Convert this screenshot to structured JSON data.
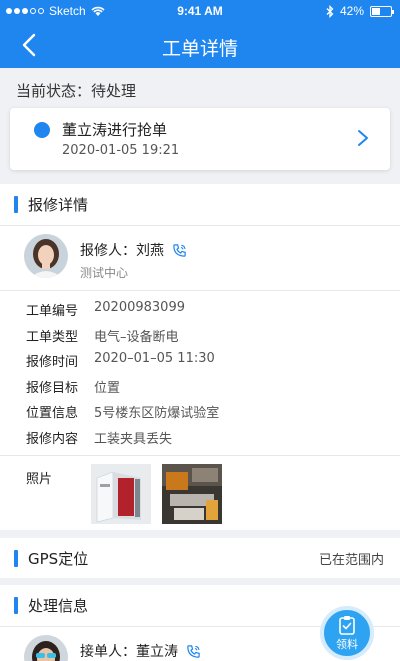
{
  "status_bar": {
    "carrier": "Sketch",
    "time": "9:41 AM",
    "battery": "42%",
    "battery_level": 0.42
  },
  "header": {
    "title": "工单详情"
  },
  "status_line": "当前状态：待处理",
  "event": {
    "title": "董立涛进行抢单",
    "time": "2020-01-05   19:21"
  },
  "repair_section": {
    "title": "报修详情",
    "reporter_label": "报修人：刘燕",
    "department": "测试中心",
    "fields": [
      {
        "key": "工单编号",
        "value": "20200983099"
      },
      {
        "key": "工单类型",
        "value": "电气–设备断电"
      },
      {
        "key": "报修时间",
        "value": "2020–01–05   11:30"
      },
      {
        "key": "报修目标",
        "value": "位置"
      },
      {
        "key": "位置信息",
        "value": "5号楼东区防爆试验室"
      },
      {
        "key": "报修内容",
        "value": "工装夹具丢失"
      }
    ],
    "photos_label": "照片"
  },
  "gps_section": {
    "title": "GPS定位",
    "status": "已在范围内"
  },
  "process_section": {
    "title": "处理信息",
    "receiver_label": "接单人：董立涛"
  },
  "fab": {
    "label": "领料"
  },
  "colors": {
    "primary": "#1f86f0",
    "background": "#f0f1f5"
  }
}
